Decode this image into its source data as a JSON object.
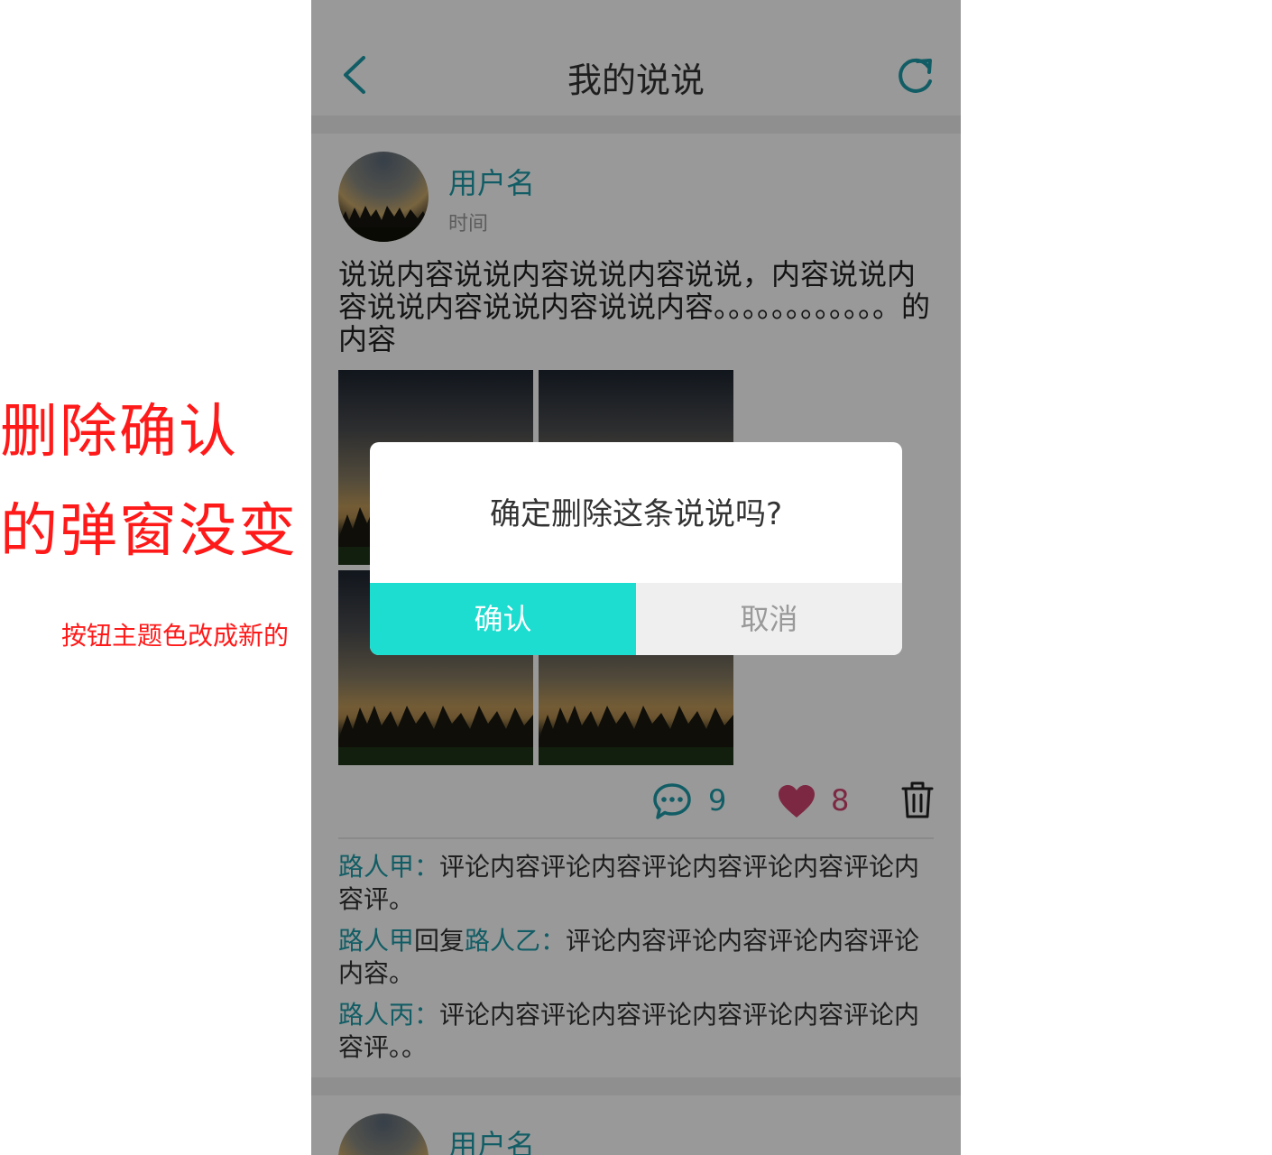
{
  "annotation": {
    "line1": "删除确认",
    "line2": "的弹窗没变",
    "note": "按钮主题色改成新的"
  },
  "colors": {
    "accent": "#1e9ca8",
    "confirm_button": "#1ddcd0",
    "like": "#d0436f",
    "annotation": "#ff1a1a"
  },
  "header": {
    "title": "我的说说",
    "back_icon": "chevron-left-icon",
    "refresh_icon": "refresh-icon"
  },
  "post": {
    "username": "用户名",
    "time": "时间",
    "content": "说说内容说说内容说说内容说说，内容说说内容说说内容说说内容说说内容。。。。。。。。。。。。的内容",
    "photo_count": 4,
    "comment_count": "9",
    "like_count": "8",
    "comments": [
      {
        "name": "路人甲：",
        "text": "评论内容评论内容评论内容评论内容评论内容评。"
      },
      {
        "name": "路人甲",
        "reply_word": "回复",
        "reply_to": "路人乙：",
        "text": "评论内容评论内容评论内容评论内容。"
      },
      {
        "name": "路人丙：",
        "text": "评论内容评论内容评论内容评论内容评论内容评。。"
      }
    ]
  },
  "post2": {
    "username": "用户名"
  },
  "dialog": {
    "message": "确定删除这条说说吗?",
    "confirm": "确认",
    "cancel": "取消"
  }
}
